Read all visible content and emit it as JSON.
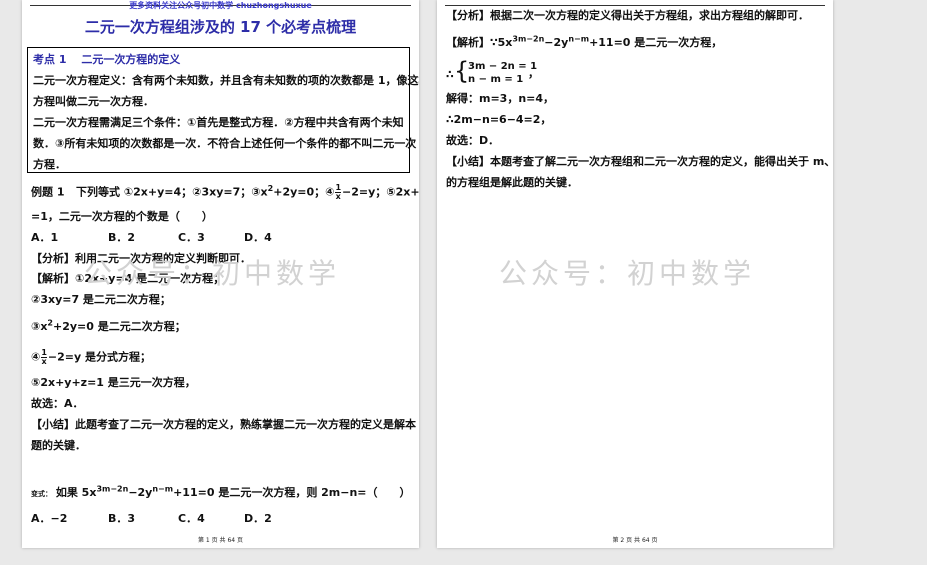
{
  "page1": {
    "header": "更多资料关注公众号初中数学 chuzhongshuxue",
    "title": "二元一次方程组涉及的 17 个必考点梳理",
    "box": {
      "heading": "考点 1　 二元一次方程的定义",
      "lines": [
        "二元一次方程定义：含有两个未知数，并且含有未知数的项的次数都是 1，像这样",
        "方程叫做二元一次方程．",
        "二元一次方程需满足三个条件：①首先是整式方程．②方程中共含有两个未知",
        "数．③所有未知项的次数都是一次．不符合上述任何一个条件的都不叫二元一次",
        "方程．"
      ]
    },
    "example": {
      "label": "例题 1",
      "stem_a": "下列等式 ①2x+y=4；②3xy=7；③x",
      "stem_a_sup": "2",
      "stem_a2": "+2y=0；④",
      "frac_num": "1",
      "frac_den": "x",
      "stem_a3": "−2=y；⑤2x+y+z",
      "stem_b": "=1，二元一次方程的个数是（　　）",
      "options": [
        "A．1",
        "B．2",
        "C．3",
        "D．4"
      ],
      "analysis": "【分析】利用二元一次方程的定义判断即可．",
      "sol1": "【解析】①2x+y=4 是二元一次方程；",
      "sol2": "②3xy=7 是二元二次方程；",
      "sol3a": "③x",
      "sol3sup": "2",
      "sol3b": "+2y=0 是二元二次方程；",
      "sol4a": "④",
      "sol4b": "−2=y 是分式方程；",
      "sol5": "⑤2x+y+z=1 是三元一次方程，",
      "answer": "故选：A．",
      "summary1": "【小结】此题考查了二元一次方程的定义，熟练掌握二元一次方程的定义是解本",
      "summary2": "题的关键．"
    },
    "variant": {
      "label": "变式：",
      "text_a": "如果 5x",
      "sup1": "3m−2n",
      "text_b": "−2y",
      "sup2": "n−m",
      "text_c": "+11=0 是二元一次方程，则 2m−n=（　　）",
      "options": [
        "A．−2",
        "B．3",
        "C．4",
        "D．2"
      ]
    },
    "watermark": "公众号：初中数学",
    "footer": "第 1 页 共 64 页"
  },
  "page2": {
    "analysis": "【分析】根据二次一次方程的定义得出关于方程组，求出方程组的解即可．",
    "sol_a": "【解析】∵5x",
    "sol_sup1": "3m−2n",
    "sol_b": "−2y",
    "sol_sup2": "n−m",
    "sol_c": "+11=0 是二元一次方程，",
    "sys_line1": "3m − 2n = 1",
    "sys_line2": "n − m = 1",
    "therefore": "∴",
    "comma": "，",
    "solve": "解得：m=3，n=4，",
    "calc": "∴2m−n=6−4=2，",
    "answer": "故选：D．",
    "summary1": "【小结】本题考查了解二元一次方程组和二元一次方程的定义，能得出关于 m、n",
    "summary2": "的方程组是解此题的关键．",
    "watermark": "公众号：初中数学",
    "footer": "第 2 页 共 64 页"
  }
}
